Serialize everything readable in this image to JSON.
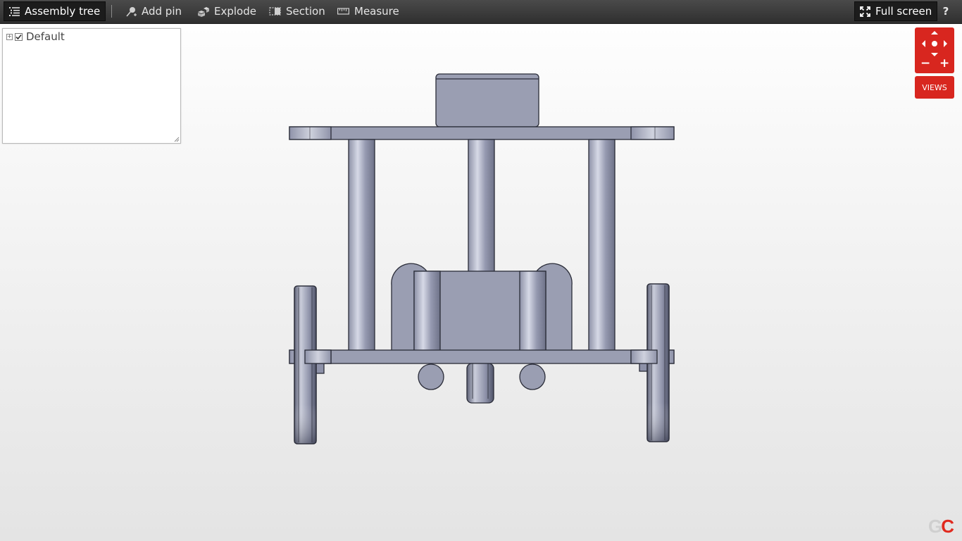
{
  "toolbar": {
    "assembly_tree": "Assembly tree",
    "add_pin": "Add pin",
    "explode": "Explode",
    "section": "Section",
    "measure": "Measure",
    "full_screen": "Full screen",
    "help": "?"
  },
  "tree": {
    "root_label": "Default",
    "root_checked": true
  },
  "nav": {
    "views_label": "VIEWS",
    "zoom_out": "−",
    "zoom_in": "+"
  },
  "logo": {
    "g": "G",
    "c": "C"
  },
  "colors": {
    "toolbar": "#3a3a3a",
    "accent_red": "#d8261f",
    "model_gray": "#9a9eb2"
  },
  "icons": {
    "assembly_tree": "list-icon",
    "add_pin": "pin-icon",
    "explode": "explode-icon",
    "section": "section-icon",
    "measure": "ruler-icon",
    "full_screen": "expand-icon"
  }
}
